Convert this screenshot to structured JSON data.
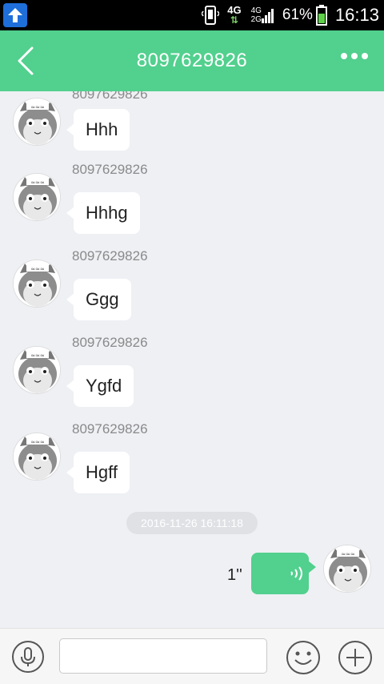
{
  "status_bar": {
    "network_label": "4G",
    "network_label_2": "4G",
    "network_label_3": "2G",
    "battery_percent": "61%",
    "time": "16:13"
  },
  "header": {
    "title": "8097629826"
  },
  "messages": [
    {
      "sender": "8097629826",
      "text": "Hhh"
    },
    {
      "sender": "8097629826",
      "text": "Hhhg"
    },
    {
      "sender": "8097629826",
      "text": "Ggg"
    },
    {
      "sender": "8097629826",
      "text": "Ygfd"
    },
    {
      "sender": "8097629826",
      "text": "Hgff"
    }
  ],
  "timestamp": "2016-11-26 16:11:18",
  "voice_message": {
    "duration": "1''"
  },
  "input_bar": {
    "text_value": "",
    "placeholder": ""
  },
  "colors": {
    "accent": "#52d08e",
    "background": "#eef0f4"
  },
  "icons": [
    "upload-icon",
    "vibrate-icon",
    "signal-icon",
    "battery-icon",
    "back-icon",
    "more-icon",
    "voice-wave-icon",
    "microphone-icon",
    "emoji-icon",
    "plus-icon"
  ]
}
